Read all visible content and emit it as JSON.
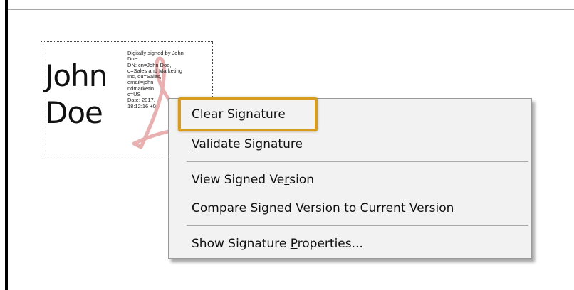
{
  "signature": {
    "name": "John\nDoe",
    "details": "Digitally signed by John\nDoe\nDN: cn=John Doe,\no=Sales and Marketing\nInc, ou=Sales,\nemail=john\nndmarketin\nc=US\nDate: 2017.\n18:12:16 +0"
  },
  "context_menu": {
    "items": [
      {
        "before": "",
        "mnemonic": "C",
        "after": "lear Signature"
      },
      {
        "before": "",
        "mnemonic": "V",
        "after": "alidate Signature"
      },
      {
        "before": "View Signed Ve",
        "mnemonic": "r",
        "after": "sion"
      },
      {
        "before": "Compare Signed Version to C",
        "mnemonic": "u",
        "after": "rrent Version"
      },
      {
        "before": "Show Signature ",
        "mnemonic": "P",
        "after": "roperties..."
      }
    ]
  },
  "colors": {
    "highlight_border": "#d79b1e",
    "menu_background": "#f2f2f2",
    "watermark": "#e8b0b0"
  },
  "icons": [
    "adobe-acrobat-watermark-icon"
  ]
}
